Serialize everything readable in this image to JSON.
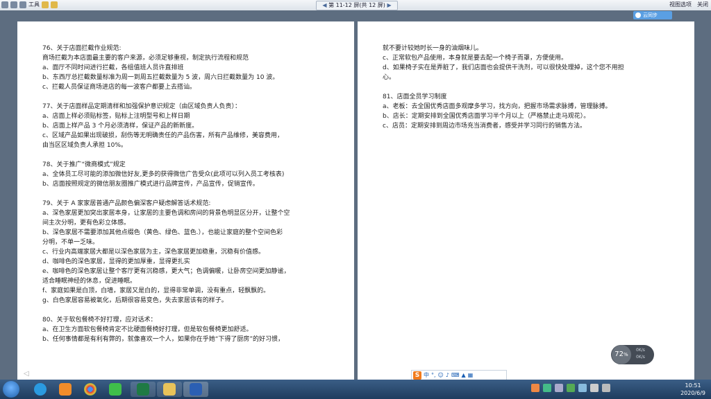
{
  "toolbar": {
    "tools_label": "工具",
    "page_nav": "第 11-12 屏(共 12 屏)",
    "view_options_label": "视图选项",
    "close_label": "关闭"
  },
  "cloud_button": "云同步",
  "left_page": [
    "76、关于店面拦截作业规范:",
    "商场拦截为本店面最主要的客户来源，必须足够重视，制定执行流程和规范",
    "a、面厅不同时间进行拦截，各组值班人员许直排班",
    "b、东西厅总拦截数量标准为周一到周五拦截数量为 5 波，周六日拦截数量为 10 波。",
    "c、拦截人员保证商场进店的每一波客户都要上去搭讪。",
    "",
    "77、关于店面样品定期清样和加强保护意识规定（由区域负责人负责）：",
    "a、店面上样必须贴标签，贴标上注明型号和上样日期",
    "b、店面上样产品 3 个月必须清样，保证产品的新新度。",
    "c、区域产品如果出现破损，刮伤等无明确责任的产品伤害，所有产品维修，美容费用，",
    "由当区区域负责人承担 10%。",
    "",
    "78、关于推广“微商模式”规定",
    "a、全体员工尽可能的添加微信好友,更多的获得微信广告受众(此项可以列入员工考核表)",
    "b、店面按照规定的微信朋友圈推广模式进行品牌宣传，产品宣传，促销宣传。",
    "",
    "79、关于 A 家家居普通产品颜色偏深客户疑虑解答话术规范:",
    "a、深色家居更加突出家居本身，让家居的主要色调和房间的背景色明显区分开，让整个空",
    "间主次分明，更有色彩立体感。",
    "b、深色家居不需要添加其他点缀色（黄色、绿色、蓝色.），也能让家庭的整个空间色彩",
    "分明，不单一乏味。",
    "c、行业内高端家居大都是以深色家居为主，深色家居更加稳重，沉稳有价值感。",
    "d、咖啡色的深色家居，显得的更加厚重，显得更扎实",
    "e、咖啡色的深色家居让整个客厅更有沉稳感，更大气；色调偏暖，让卧房空间更加静谧，",
    "适合睡眠神经的休息，促进睡眠。",
    "f、家庭如果是白顶，白墙，家居又是白的，显得非常单调，没有重点，轻飘飘的。",
    "g、白色家居容易被氧化，后期很容易变色，失去家居该有的样子。",
    "",
    "80、关于软包餐椅不好打理，应对话术：",
    "a、在卫生方面软包餐椅肯定不比硬面餐椅好打理，但是软包餐椅更加舒适。",
    "b、任何事情都是有利有弊的，就像喜欢一个人，如果你在乎她“下得了厨房”的好习惯，"
  ],
  "right_page": [
    "就不要计较她时长一身的油烟味儿。",
    "c、正常软包产品使用，本身就是要去配一个椅子而罩，方便使用。",
    "d、如果椅子实在是弄脏了，我们店面也会提供干洗剂，可以很快处理掉，这个您不用担",
    "心。",
    "",
    "81、店面全员学习制度",
    "a、老板：去全国优秀店面多观摩多学习，找方向，把握市场需求脉搏，管理脉搏。",
    "b、店长：定期安排到全国优秀店面学习半个月以上（严格禁止走马观花）。",
    "c、店员：定期安排到周边市场充当消费者，感受并学习同行的销售方法。"
  ],
  "zoom": {
    "value": "72",
    "unit": "%",
    "up_rate": "0K/s",
    "down_rate": "0K/s"
  },
  "ime": {
    "logo": "S",
    "mode": "中"
  },
  "clock": {
    "time": "10:51",
    "date": "2020/6/9"
  }
}
